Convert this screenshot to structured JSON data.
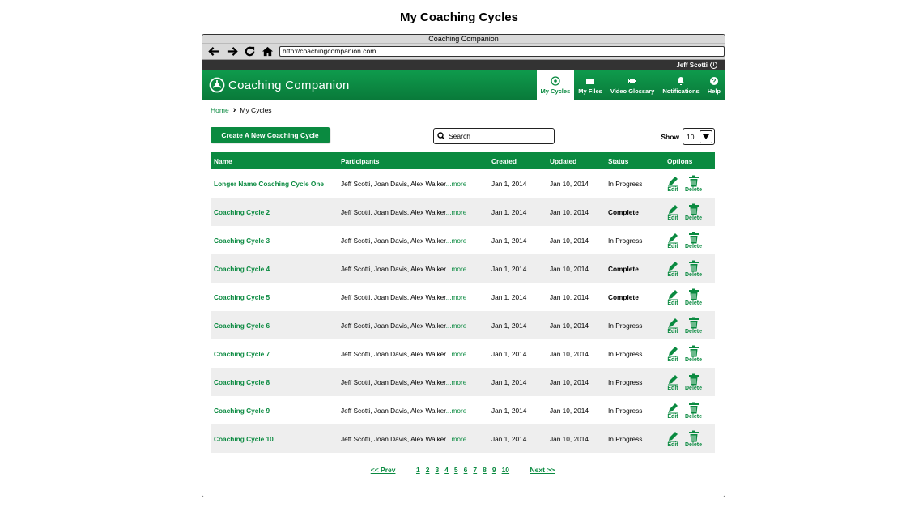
{
  "page_heading": "My Coaching Cycles",
  "browser": {
    "title": "Coaching Companion",
    "url": "http://coachingcompanion.com"
  },
  "user": {
    "name": "Jeff Scotti"
  },
  "app": {
    "logo_text": "Coaching Companion",
    "nav": [
      {
        "label": "My Cycles",
        "icon": "cycles-icon",
        "active": true
      },
      {
        "label": "My Files",
        "icon": "folder-icon"
      },
      {
        "label": "Video Glossary",
        "icon": "film-icon"
      },
      {
        "label": "Notifications",
        "icon": "bell-icon"
      },
      {
        "label": "Help",
        "icon": "help-icon"
      }
    ]
  },
  "breadcrumb": {
    "home": "Home",
    "current": "My Cycles"
  },
  "controls": {
    "create_label": "Create A New Coaching Cycle",
    "search_placeholder": "Search",
    "show_label": "Show",
    "show_value": "10"
  },
  "table": {
    "headers": [
      "Name",
      "Participants",
      "Created",
      "Updated",
      "Status",
      "Options"
    ],
    "rows": [
      {
        "name": "Longer Name Coaching Cycle One",
        "participants": "Jeff Scotti, Joan Davis, Alex Walker",
        "more": "...more",
        "created": "Jan 1, 2014",
        "updated": "Jan 10, 2014",
        "status": "In Progress"
      },
      {
        "name": "Coaching Cycle 2",
        "participants": "Jeff Scotti, Joan Davis, Alex Walker",
        "more": "...more",
        "created": "Jan 1, 2014",
        "updated": "Jan 10, 2014",
        "status": "Complete"
      },
      {
        "name": "Coaching Cycle 3",
        "participants": "Jeff Scotti, Joan Davis, Alex Walker",
        "more": "...more",
        "created": "Jan 1, 2014",
        "updated": "Jan 10, 2014",
        "status": "In Progress"
      },
      {
        "name": "Coaching Cycle 4",
        "participants": "Jeff Scotti, Joan Davis, Alex Walker",
        "more": "...more",
        "created": "Jan 1, 2014",
        "updated": "Jan 10, 2014",
        "status": "Complete"
      },
      {
        "name": "Coaching Cycle 5",
        "participants": "Jeff Scotti, Joan Davis, Alex Walker",
        "more": "...more",
        "created": "Jan 1, 2014",
        "updated": "Jan 10, 2014",
        "status": "Complete"
      },
      {
        "name": "Coaching Cycle 6",
        "participants": "Jeff Scotti, Joan Davis, Alex Walker",
        "more": "...more",
        "created": "Jan 1, 2014",
        "updated": "Jan 10, 2014",
        "status": "In Progress"
      },
      {
        "name": "Coaching Cycle 7",
        "participants": "Jeff Scotti, Joan Davis, Alex Walker",
        "more": "...more",
        "created": "Jan 1, 2014",
        "updated": "Jan 10, 2014",
        "status": "In Progress"
      },
      {
        "name": "Coaching Cycle 8",
        "participants": "Jeff Scotti, Joan Davis, Alex Walker",
        "more": "...more",
        "created": "Jan 1, 2014",
        "updated": "Jan 10, 2014",
        "status": "In Progress"
      },
      {
        "name": "Coaching Cycle 9",
        "participants": "Jeff Scotti, Joan Davis, Alex Walker",
        "more": "...more",
        "created": "Jan 1, 2014",
        "updated": "Jan 10, 2014",
        "status": "In Progress"
      },
      {
        "name": "Coaching Cycle 10",
        "participants": "Jeff Scotti, Joan Davis, Alex Walker",
        "more": "...more",
        "created": "Jan 1, 2014",
        "updated": "Jan 10, 2014",
        "status": "In Progress"
      }
    ],
    "edit_label": "Edit",
    "delete_label": "Delete"
  },
  "pagination": {
    "prev": "<< Prev",
    "pages": [
      "1",
      "2",
      "3",
      "4",
      "5",
      "6",
      "7",
      "8",
      "9",
      "10"
    ],
    "next": "Next >>"
  },
  "colors": {
    "brand_green": "#0a8a40",
    "row_alt": "#eeeeee"
  }
}
